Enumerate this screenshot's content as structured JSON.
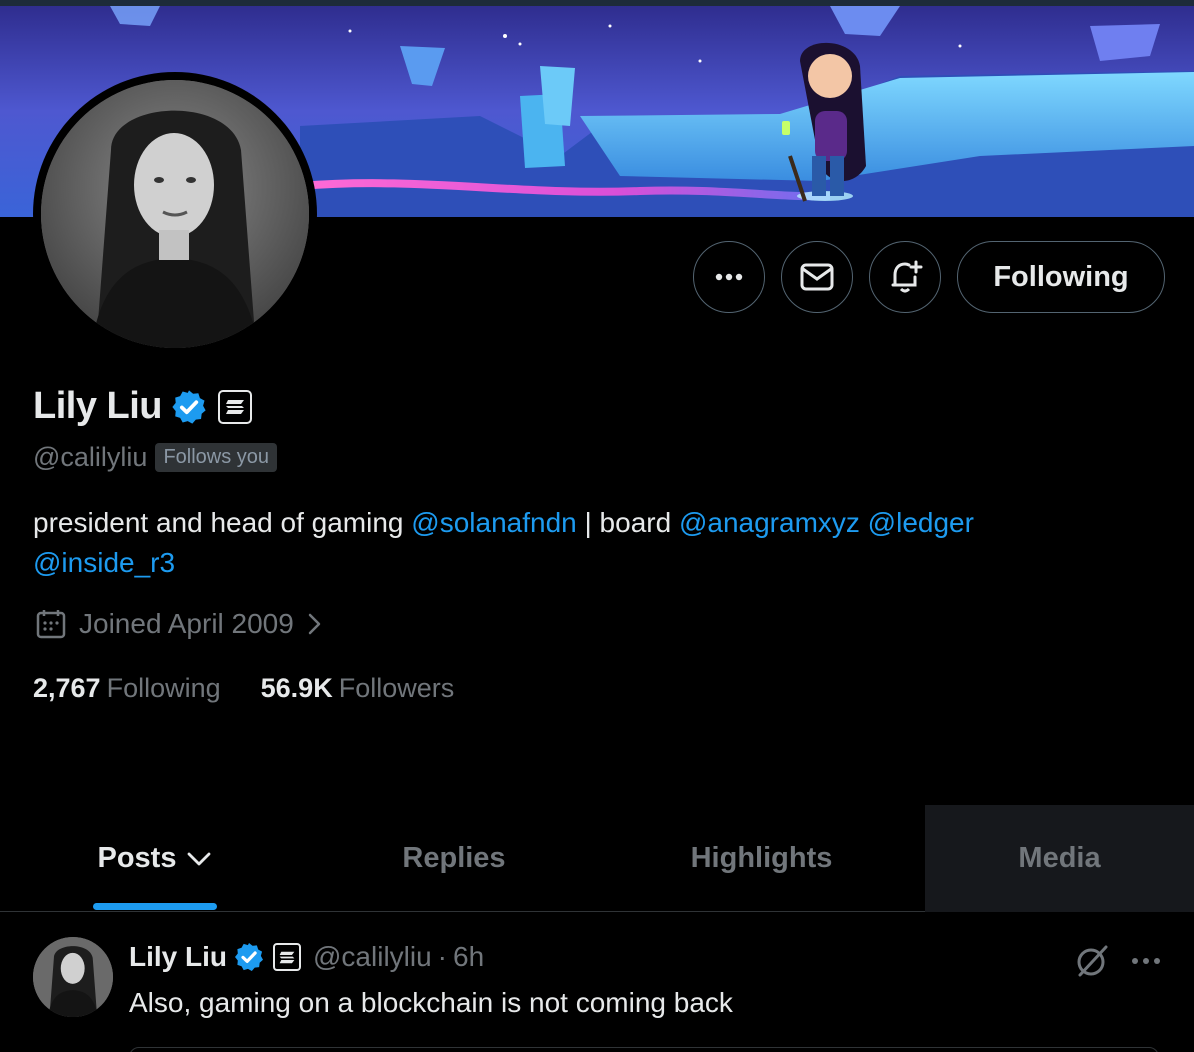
{
  "profile": {
    "name": "Lily Liu",
    "handle": "@calilyliu",
    "follows_you": "Follows you",
    "bio_parts": [
      {
        "text": "president and head of gaming ",
        "type": "text"
      },
      {
        "text": "@solanafndn",
        "type": "mention"
      },
      {
        "text": " | board ",
        "type": "text"
      },
      {
        "text": "@anagramxyz",
        "type": "mention"
      },
      {
        "text": " ",
        "type": "text"
      },
      {
        "text": "@ledger",
        "type": "mention"
      },
      {
        "text": " ",
        "type": "text"
      },
      {
        "text": "@inside_r3",
        "type": "mention"
      }
    ],
    "joined": "Joined April 2009",
    "following_count": "2,767",
    "following_label": "Following",
    "followers_count": "56.9K",
    "followers_label": "Followers"
  },
  "actions": {
    "more_icon": "more-dots-icon",
    "message_icon": "envelope-icon",
    "notify_icon": "bell-plus-icon",
    "follow_label": "Following"
  },
  "tabs": [
    {
      "label": "Posts",
      "active": true,
      "dropdown": true
    },
    {
      "label": "Replies",
      "active": false
    },
    {
      "label": "Highlights",
      "active": false
    },
    {
      "label": "Media",
      "active": false,
      "hovered": true
    }
  ],
  "post": {
    "name": "Lily Liu",
    "handle": "@calilyliu",
    "time": "6h",
    "text": "Also, gaming on a blockchain is not coming back"
  },
  "colors": {
    "accent": "#1d9bf0",
    "background": "#000000",
    "muted": "#71767b",
    "border": "#536471"
  }
}
